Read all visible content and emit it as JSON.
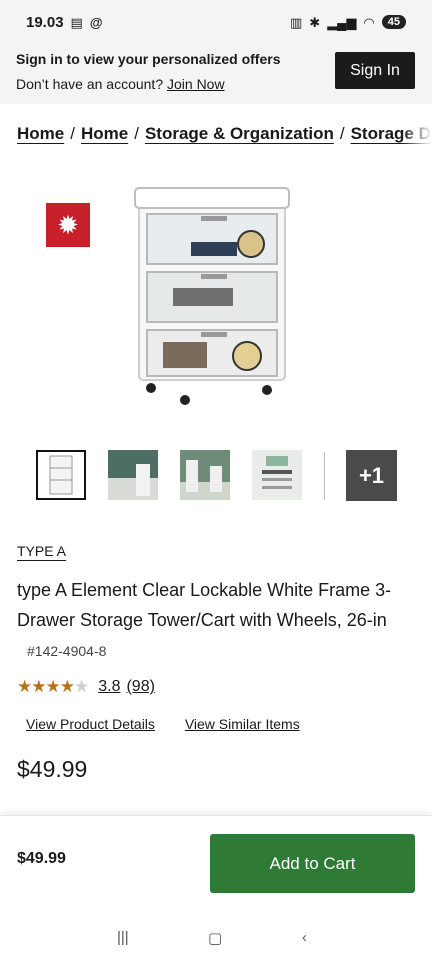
{
  "status": {
    "time": "19.03",
    "icons_left": [
      "stack-icon",
      "threads-icon"
    ],
    "icons_right": [
      "nfc-icon",
      "bluetooth-icon",
      "signal-icon",
      "wifi-icon"
    ],
    "battery": "45"
  },
  "signin": {
    "title": "Sign in to view your personalized offers",
    "prompt": "Don’t have an account?",
    "join_label": "Join Now",
    "button_label": "Sign In"
  },
  "breadcrumb": {
    "items": [
      "Home",
      "Home",
      "Storage & Organization",
      "Storage D"
    ],
    "separator": "/"
  },
  "product": {
    "brand": "TYPE A",
    "title": "type A Element Clear Lockable White Frame 3-Drawer Storage Tower/Cart with Wheels, 26-in",
    "sku": "#142-4904-8",
    "rating_value": "3.8",
    "review_count": "(98)",
    "rating_fraction": 0.76,
    "price": "$49.99",
    "thumb_more_label": "+1"
  },
  "links": {
    "details": "View Product Details",
    "similar": "View Similar Items"
  },
  "bottom_bar": {
    "price": "$49.99",
    "cart_label": "Add to Cart"
  },
  "colors": {
    "cart_button": "#2f7a35",
    "star": "#b8731a",
    "flag": "#c8202a"
  }
}
